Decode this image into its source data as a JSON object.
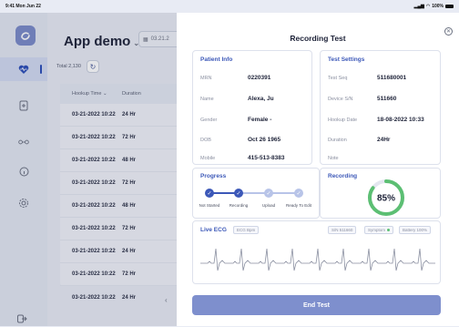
{
  "status_bar": {
    "time": "9:41 Mon Jun 22",
    "battery": "100%"
  },
  "app": {
    "title": "App demo",
    "date_value": "03.21.2"
  },
  "list": {
    "total_label": "Total 2,130",
    "columns": [
      "Hookup Time",
      "Duration"
    ],
    "rows": [
      {
        "time": "03-21-2022 10:22",
        "duration": "24 Hr"
      },
      {
        "time": "03-21-2022 10:22",
        "duration": "72 Hr"
      },
      {
        "time": "03-21-2022 10:22",
        "duration": "48 Hr"
      },
      {
        "time": "03-21-2022 10:22",
        "duration": "72 Hr"
      },
      {
        "time": "03-21-2022 10:22",
        "duration": "48 Hr"
      },
      {
        "time": "03-21-2022 10:22",
        "duration": "72 Hr"
      },
      {
        "time": "03-21-2022 10:22",
        "duration": "24 Hr"
      },
      {
        "time": "03-21-2022 10:22",
        "duration": "72 Hr"
      },
      {
        "time": "03-21-2022 10:22",
        "duration": "24 Hr"
      }
    ]
  },
  "panel": {
    "title": "Recording Test",
    "patient": {
      "title": "Patient Info",
      "fields": [
        {
          "label": "MRN",
          "value": "0220391"
        },
        {
          "label": "Name",
          "value": "Alexa, Ju"
        },
        {
          "label": "Gender",
          "value": "Female -"
        },
        {
          "label": "DOB",
          "value": "Oct 26 1965"
        },
        {
          "label": "Mobile",
          "value": "415-513-8383"
        }
      ]
    },
    "settings": {
      "title": "Test Settings",
      "fields": [
        {
          "label": "Test Seq",
          "value": "511680001"
        },
        {
          "label": "Device S/N",
          "value": "511660"
        },
        {
          "label": "Hookup Date",
          "value": "18-08-2022 10:33"
        },
        {
          "label": "Duration",
          "value": "24Hr"
        },
        {
          "label": "Note",
          "value": ""
        }
      ]
    },
    "progress": {
      "title": "Progress",
      "steps": [
        "Not Started",
        "Recording",
        "Upload",
        "Ready To Edit"
      ]
    },
    "recording": {
      "title": "Recording",
      "percent_label": "85%",
      "percent": 85
    },
    "ecg": {
      "title": "Live ECG",
      "rate_chip": "ECG Bpm",
      "serial_chip": "S/N 511660",
      "symptom_chip": "Symptom",
      "battery_chip": "Battery 100%"
    },
    "end_button": "End Test"
  },
  "colors": {
    "accent": "#3c58b8",
    "button": "#7e8fcd",
    "ring": "#5cbf73"
  }
}
